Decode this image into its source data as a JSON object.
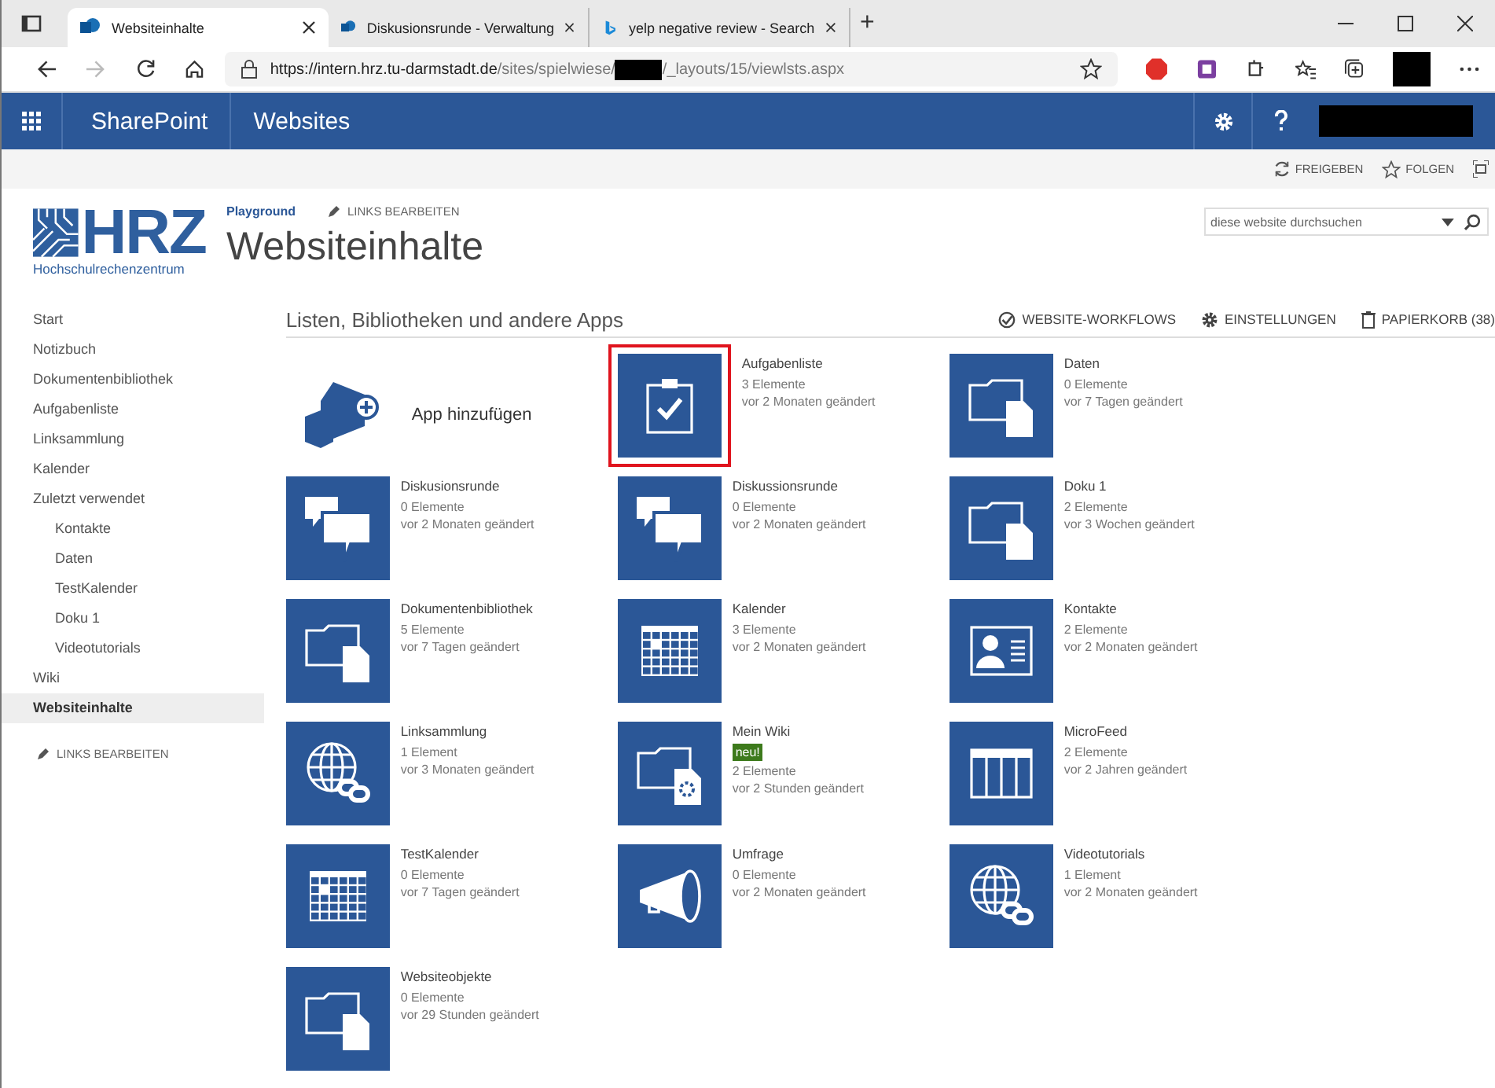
{
  "browser": {
    "tabs": [
      {
        "title": "Websiteinhalte",
        "selected": true
      },
      {
        "title": "Diskusionsrunde - Verwaltung",
        "selected": false
      },
      {
        "title": "yelp negative review - Search",
        "selected": false
      }
    ],
    "new_tab": "+",
    "url_host": "https://intern.hrz.tu-darmstadt.de",
    "url_path": "/sites/spielwiese/",
    "url_rest": "/_layouts/15/viewlsts.aspx"
  },
  "suite_bar": {
    "brand": "SharePoint",
    "section": "Websites"
  },
  "ribbon": {
    "actions": [
      "FREIGEBEN",
      "FOLGEN"
    ]
  },
  "header": {
    "logo_text": "HRZ",
    "logo_sub": "Hochschulrechenzentrum",
    "site": "Playground",
    "edit_links": "LINKS BEARBEITEN",
    "title": "Websiteinhalte",
    "search": {
      "placeholder": "diese website durchsuchen"
    }
  },
  "sidebar": {
    "items": [
      {
        "label": "Start",
        "selected": false
      },
      {
        "label": "Notizbuch",
        "selected": false
      },
      {
        "label": "Dokumentenbibliothek",
        "selected": false
      },
      {
        "label": "Aufgabenliste",
        "selected": false
      },
      {
        "label": "Linksammlung",
        "selected": false
      },
      {
        "label": "Kalender",
        "selected": false
      },
      {
        "label": "Zuletzt verwendet",
        "selected": false,
        "children": [
          {
            "label": "Kontakte",
            "selected": false
          },
          {
            "label": "Daten",
            "selected": false
          },
          {
            "label": "TestKalender",
            "selected": false
          },
          {
            "label": "Doku 1",
            "selected": false
          },
          {
            "label": "Videotutorials",
            "selected": false
          }
        ]
      },
      {
        "label": "Wiki",
        "selected": false
      },
      {
        "label": "Websiteinhalte",
        "selected": true
      }
    ],
    "edit_links": "LINKS BEARBEITEN"
  },
  "content": {
    "heading": "Listen, Bibliotheken und andere Apps",
    "actions": [
      "WEBSITE-WORKFLOWS",
      "EINSTELLUNGEN",
      "PAPIERKORB (38)"
    ],
    "add_app": "App hinzufügen",
    "tiles": [
      {
        "name": "Aufgabenliste",
        "kind": "tasks",
        "highlighted": true,
        "count": "3 Elemente",
        "modified": "vor 2 Monaten geändert"
      },
      {
        "name": "Daten",
        "kind": "library",
        "highlighted": false,
        "count": "0 Elemente",
        "modified": "vor 7 Tagen geändert"
      },
      {
        "name": "Diskusionsrunde",
        "kind": "discussion",
        "highlighted": false,
        "count": "0 Elemente",
        "modified": "vor 2 Monaten geändert"
      },
      {
        "name": "Diskussionsrunde",
        "kind": "discussion",
        "highlighted": false,
        "count": "0 Elemente",
        "modified": "vor 2 Monaten geändert"
      },
      {
        "name": "Doku 1",
        "kind": "library",
        "highlighted": false,
        "count": "2 Elemente",
        "modified": "vor 3 Wochen geändert"
      },
      {
        "name": "Dokumentenbibliothek",
        "kind": "library",
        "highlighted": false,
        "count": "5 Elemente",
        "modified": "vor 7 Tagen geändert"
      },
      {
        "name": "Kalender",
        "kind": "calendar",
        "highlighted": false,
        "count": "3 Elemente",
        "modified": "vor 2 Monaten geändert"
      },
      {
        "name": "Kontakte",
        "kind": "contacts",
        "highlighted": false,
        "count": "2 Elemente",
        "modified": "vor 2 Monaten geändert"
      },
      {
        "name": "Linksammlung",
        "kind": "links",
        "highlighted": false,
        "count": "1 Element",
        "modified": "vor 3 Monaten geändert"
      },
      {
        "name": "Mein Wiki",
        "kind": "wiki",
        "highlighted": false,
        "badge": "neu!",
        "count": "2 Elemente",
        "modified": "vor 2 Stunden geändert"
      },
      {
        "name": "MicroFeed",
        "kind": "list",
        "highlighted": false,
        "count": "2 Elemente",
        "modified": "vor 2 Jahren geändert"
      },
      {
        "name": "TestKalender",
        "kind": "calendar",
        "highlighted": false,
        "count": "0 Elemente",
        "modified": "vor 7 Tagen geändert"
      },
      {
        "name": "Umfrage",
        "kind": "survey",
        "highlighted": false,
        "count": "0 Elemente",
        "modified": "vor 2 Monaten geändert"
      },
      {
        "name": "Videotutorials",
        "kind": "links",
        "highlighted": false,
        "count": "1 Element",
        "modified": "vor 2 Monaten geändert"
      },
      {
        "name": "Websiteobjekte",
        "kind": "library",
        "highlighted": false,
        "count": "0 Elemente",
        "modified": "vor 29 Stunden geändert"
      }
    ]
  }
}
